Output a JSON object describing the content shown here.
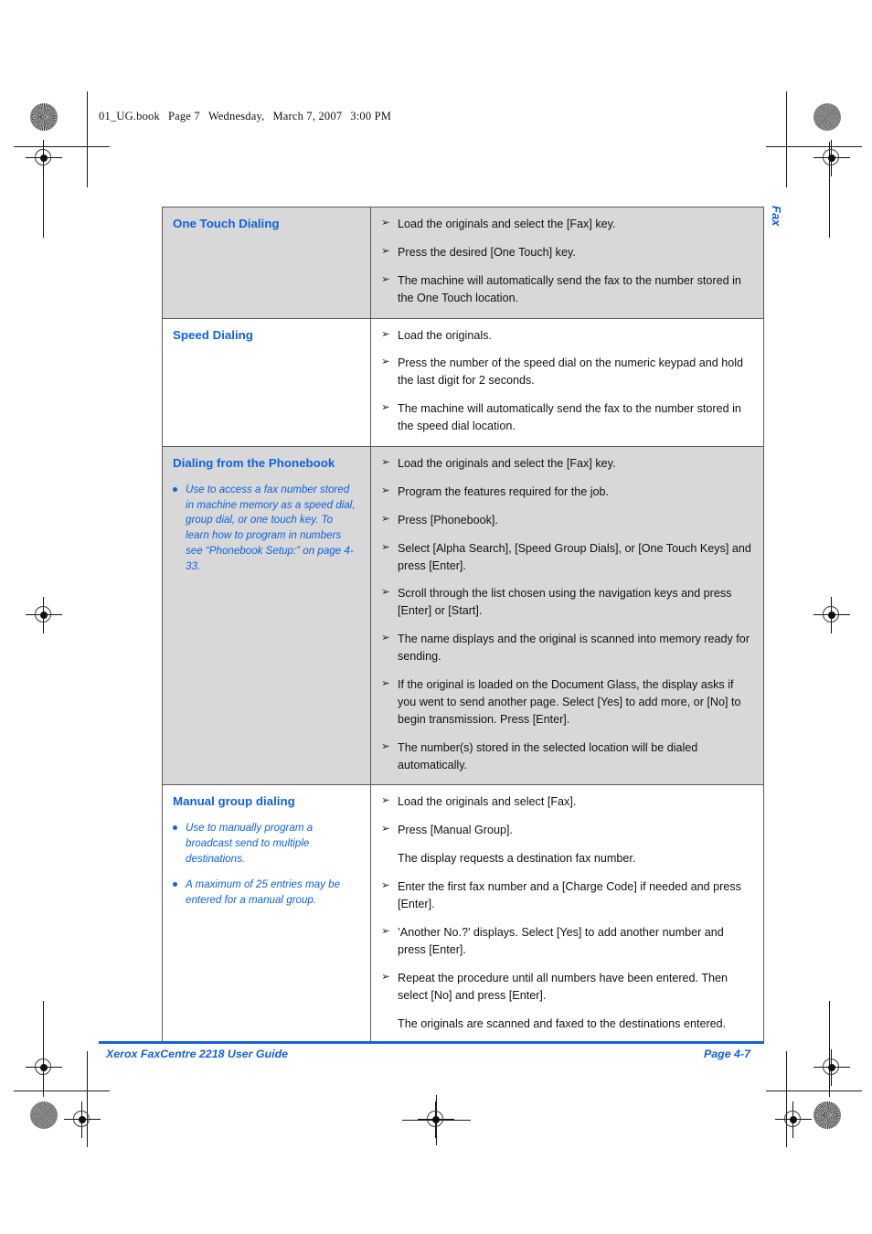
{
  "file_header": {
    "book": "01_UG.book",
    "page": "Page 7",
    "weekday": "Wednesday,",
    "date": "March 7, 2007",
    "time": "3:00 PM"
  },
  "chapter_tab": {
    "label": "Fax"
  },
  "colors": {
    "heading_blue": "#0f62e0",
    "shaded_row": "#d8d8d8",
    "table_border": "#5a5a5a"
  },
  "icons": {
    "step_arrow": "➢",
    "note_bullet": "bullet-dot-icon"
  },
  "table": {
    "rows": [
      {
        "shaded": true,
        "title": "One Touch Dialing",
        "notes": [],
        "steps": [
          {
            "arrow": true,
            "text": "Load the originals and select the [Fax] key."
          },
          {
            "arrow": true,
            "text": "Press the desired [One Touch] key."
          },
          {
            "arrow": true,
            "text": "The machine will automatically send the fax to the number stored in the One Touch location."
          }
        ]
      },
      {
        "shaded": false,
        "title": "Speed Dialing",
        "notes": [],
        "steps": [
          {
            "arrow": true,
            "text": "Load the originals."
          },
          {
            "arrow": true,
            "text": "Press the number of the speed dial on the numeric keypad and hold the last digit for 2 seconds."
          },
          {
            "arrow": true,
            "text": "The machine will automatically send the fax to the number stored in the speed dial location."
          }
        ]
      },
      {
        "shaded": true,
        "title": "Dialing from the Phonebook",
        "notes": [
          "Use to access a fax number stored in machine memory as a speed dial, group dial, or one touch key. To learn how to program in numbers see “Phonebook Setup:” on page 4-33."
        ],
        "steps": [
          {
            "arrow": true,
            "text": "Load the originals and select the [Fax] key."
          },
          {
            "arrow": true,
            "text": "Program the features required for the job."
          },
          {
            "arrow": true,
            "text": "Press [Phonebook]."
          },
          {
            "arrow": true,
            "text": "Select [Alpha Search], [Speed Group Dials], or [One Touch Keys] and press [Enter]."
          },
          {
            "arrow": true,
            "text": "Scroll through the list chosen using the navigation keys and press [Enter] or [Start]."
          },
          {
            "arrow": true,
            "text": "The name displays and the original is scanned into memory ready for sending."
          },
          {
            "arrow": true,
            "text": "If the original is loaded on the Document Glass, the display asks if you went to send another page. Select [Yes] to add more, or [No] to begin transmission. Press [Enter]."
          },
          {
            "arrow": true,
            "text": "The number(s) stored in the selected location will be dialed automatically."
          }
        ]
      },
      {
        "shaded": false,
        "title": "Manual group dialing",
        "notes": [
          "Use to manually program a broadcast send to multiple destinations.",
          "A maximum of 25 entries may be entered for a manual group."
        ],
        "steps": [
          {
            "arrow": true,
            "text": "Load the originals and select [Fax]."
          },
          {
            "arrow": true,
            "text": "Press [Manual Group]."
          },
          {
            "arrow": false,
            "text": "The display requests a destination fax number."
          },
          {
            "arrow": true,
            "text": "Enter the first fax number and a [Charge Code] if needed and press [Enter]."
          },
          {
            "arrow": true,
            "text": "’Another No.?’ displays. Select [Yes] to add another number and press [Enter]."
          },
          {
            "arrow": true,
            "text": "Repeat the procedure until all numbers have been entered. Then select [No] and press [Enter]."
          },
          {
            "arrow": false,
            "text": "The originals are scanned and faxed to the destinations entered."
          }
        ]
      }
    ]
  },
  "footer": {
    "guide_title": "Xerox FaxCentre 2218 User Guide",
    "page_number": "Page 4-7"
  }
}
